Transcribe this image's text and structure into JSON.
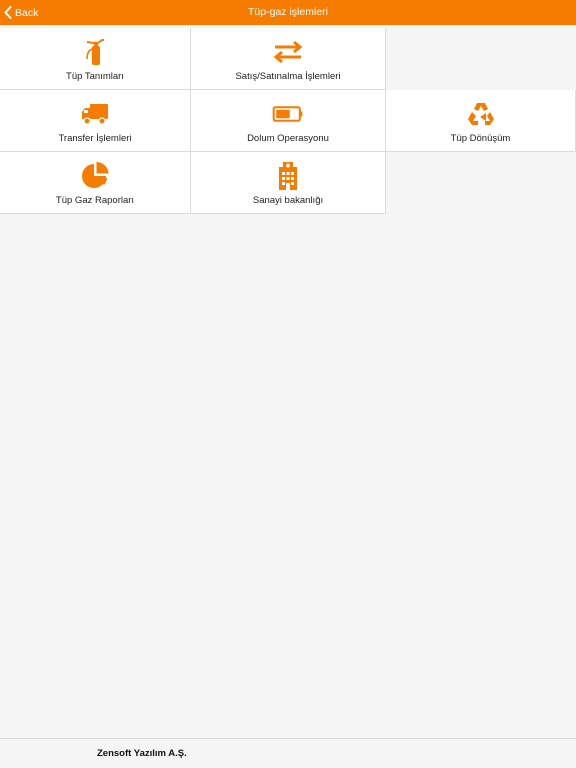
{
  "navbar": {
    "back_label": "Back",
    "title": "Tüp-gaz işlemleri",
    "color": "#f57c00"
  },
  "accent_color": "#f57c00",
  "menu": {
    "items": [
      {
        "label": "Tüp Tanımları",
        "icon": "fire-extinguisher-icon"
      },
      {
        "label": "Satış/Satınalma İşlemleri",
        "icon": "swap-arrows-icon"
      },
      {
        "label": "Transfer İşlemleri",
        "icon": "truck-icon"
      },
      {
        "label": "Dolum Operasyonu",
        "icon": "battery-icon"
      },
      {
        "label": "Tüp Dönüşüm",
        "icon": "recycle-icon"
      },
      {
        "label": "Tüp Gaz Raporları",
        "icon": "pie-chart-icon"
      },
      {
        "label": "Sanayi bakanlığı",
        "icon": "building-icon"
      }
    ]
  },
  "footer": {
    "company": "Zensoft Yazılım A.Ş."
  }
}
